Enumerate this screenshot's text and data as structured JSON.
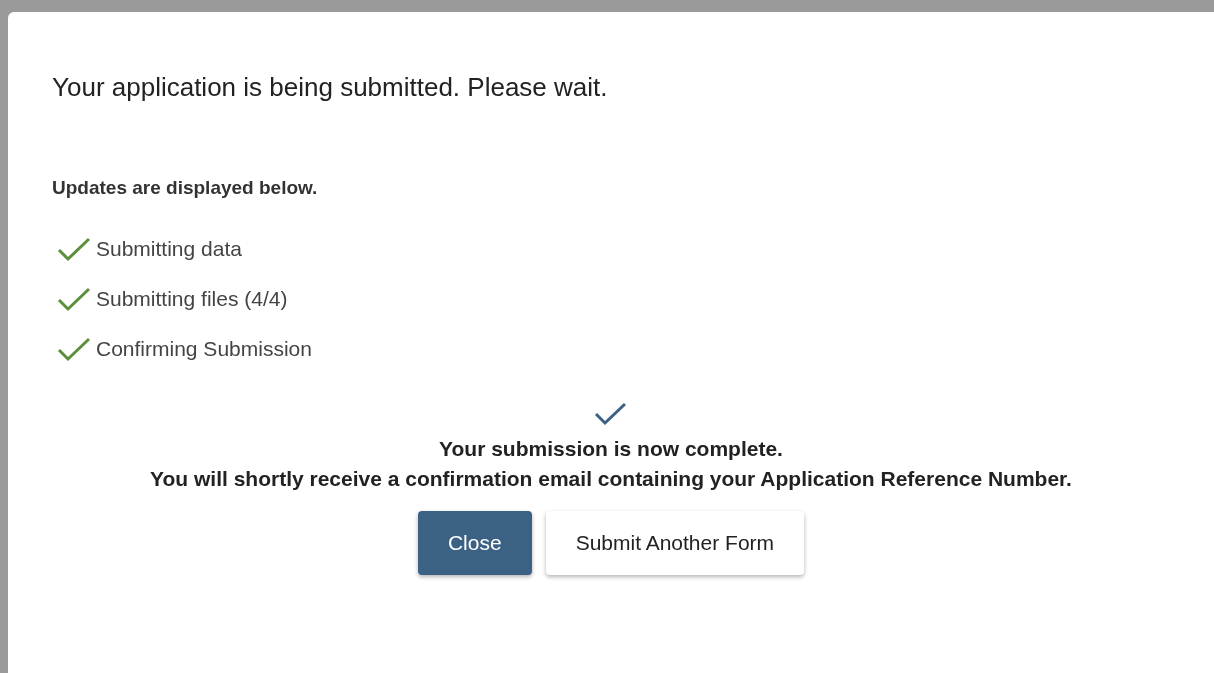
{
  "dialog": {
    "title": "Your application is being submitted. Please wait.",
    "subtitle": "Updates are displayed below.",
    "steps": [
      {
        "label": "Submitting data",
        "done": true
      },
      {
        "label": "Submitting files (4/4)",
        "done": true
      },
      {
        "label": "Confirming Submission",
        "done": true
      }
    ],
    "complete": true,
    "messages": [
      "Your submission is now complete.",
      "You will shortly receive a confirmation email containing your Application Reference Number."
    ],
    "buttons": [
      {
        "label": "Close",
        "kind": "primary"
      },
      {
        "label": "Submit Another Form",
        "kind": "secondary"
      }
    ]
  }
}
